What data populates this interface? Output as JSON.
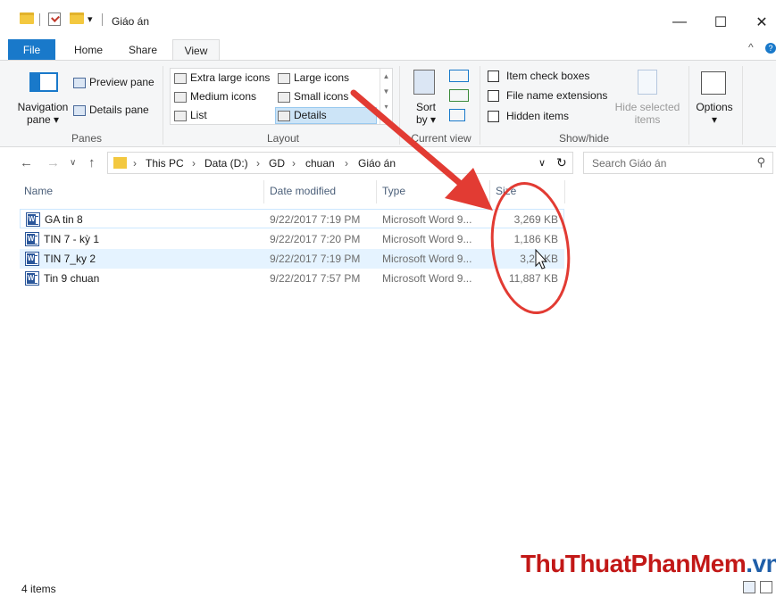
{
  "window": {
    "title": "Giáo án",
    "quick_access_dropdown": "▾",
    "controls": {
      "minimize": "—",
      "maximize": "☐",
      "close": "✕"
    }
  },
  "ribbon_tabs": [
    {
      "label": "File"
    },
    {
      "label": "Home"
    },
    {
      "label": "Share"
    },
    {
      "label": "View"
    }
  ],
  "ribbon_right": {
    "collapse": "^",
    "help": "?"
  },
  "ribbon": {
    "panes": {
      "label": "Panes",
      "navigation_pane_line1": "Navigation",
      "navigation_pane_line2": "pane",
      "preview_pane": "Preview pane",
      "details_pane": "Details pane"
    },
    "layout": {
      "label": "Layout",
      "items": [
        "Extra large icons",
        "Large icons",
        "Medium icons",
        "Small icons",
        "List",
        "Details"
      ],
      "selected": "Details"
    },
    "current_view": {
      "label": "Current view",
      "sort_line1": "Sort",
      "sort_line2": "by"
    },
    "show_hide": {
      "label": "Show/hide",
      "item_check_boxes": "Item check boxes",
      "file_name_extensions": "File name extensions",
      "hidden_items": "Hidden items",
      "hide_selected_line1": "Hide selected",
      "hide_selected_line2": "items"
    },
    "options": {
      "label": "Options"
    }
  },
  "address_bar": {
    "crumbs": [
      "This PC",
      "Data (D:)",
      "GD",
      "chuan",
      "Giáo án"
    ],
    "search_placeholder": "Search Giáo án"
  },
  "columns": [
    "Name",
    "Date modified",
    "Type",
    "Size"
  ],
  "files": [
    {
      "name": "GA tin 8",
      "date": "9/22/2017 7:19 PM",
      "type": "Microsoft Word 9...",
      "size": "3,269 KB"
    },
    {
      "name": "TIN 7 - kỳ 1",
      "date": "9/22/2017 7:20 PM",
      "type": "Microsoft Word 9...",
      "size": "1,186 KB"
    },
    {
      "name": "TIN 7_ky 2",
      "date": "9/22/2017 7:19 PM",
      "type": "Microsoft Word 9...",
      "size": "3,24 KB"
    },
    {
      "name": "Tin 9 chuan",
      "date": "9/22/2017 7:57 PM",
      "type": "Microsoft Word 9...",
      "size": "11,887 KB"
    }
  ],
  "status": {
    "item_count": "4 items"
  },
  "watermark": {
    "part1": "ThuThuat",
    "part2": "PhanMem",
    "part3": ".vn"
  },
  "colors": {
    "accent": "#1979ca",
    "annotation": "#e23b33",
    "selection": "#e5f3ff"
  }
}
